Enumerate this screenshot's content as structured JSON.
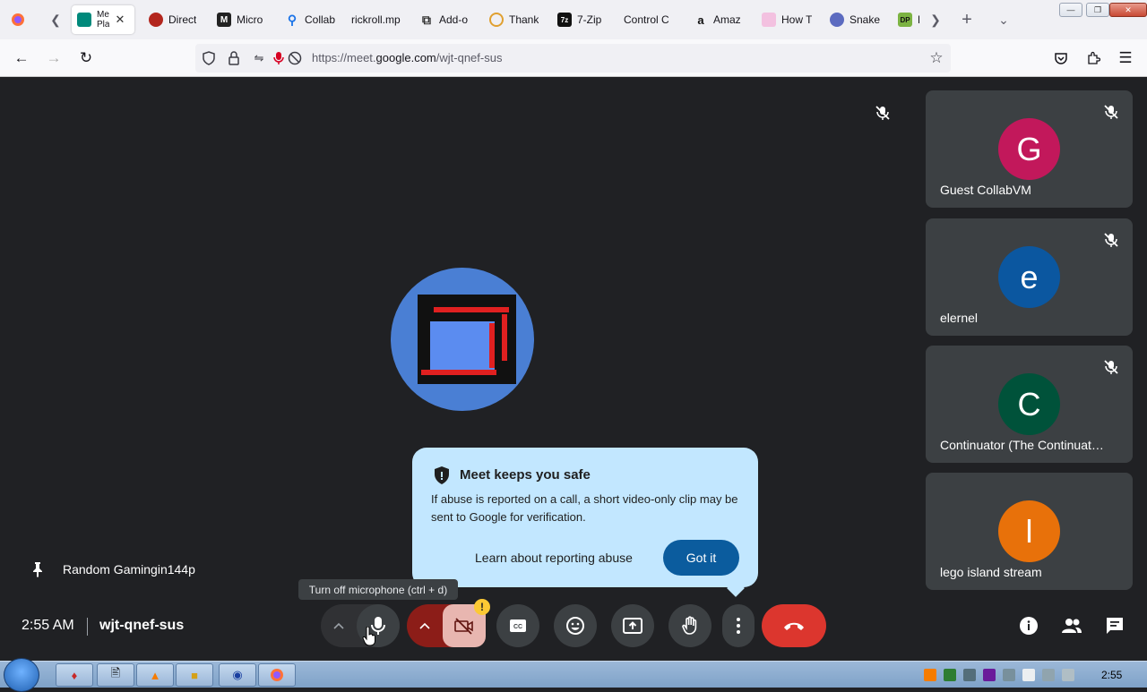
{
  "browser": {
    "tabs": [
      {
        "label": "Me",
        "sub": "Pla",
        "color": "#00897b",
        "letter": ""
      },
      {
        "label": "Direct",
        "color": "#b3261e",
        "letter": ""
      },
      {
        "label": "Micro",
        "color": "#222222",
        "letter": "M"
      },
      {
        "label": "Collab",
        "color": "#1a73e8",
        "letter": ""
      },
      {
        "label": "rickroll.mp",
        "color": "",
        "letter": ""
      },
      {
        "label": "Add-o",
        "color": "#555555",
        "letter": ""
      },
      {
        "label": "Thank",
        "color": "#e0a030",
        "letter": ""
      },
      {
        "label": "7-Zip",
        "color": "#111111",
        "letter": "7z"
      },
      {
        "label": "Control C",
        "color": "",
        "letter": ""
      },
      {
        "label": "Amaz",
        "color": "#222222",
        "letter": "a"
      },
      {
        "label": "How T",
        "color": "#e040a0",
        "letter": ""
      },
      {
        "label": "Snake",
        "color": "#5c6bc0",
        "letter": ""
      },
      {
        "label": "D",
        "color": "#7cb342",
        "letter": "DP"
      }
    ],
    "url_prefix": "https://meet.",
    "url_domain": "google.com",
    "url_path": "/wjt-qnef-sus"
  },
  "meet": {
    "participants": [
      {
        "initial": "G",
        "name": "Guest CollabVM",
        "color": "#c2185b"
      },
      {
        "initial": "e",
        "name": "elernel",
        "color": "#0b57a0"
      },
      {
        "initial": "C",
        "name": "Continuator (The Continuat…",
        "color": "#00523a"
      },
      {
        "initial": "l",
        "name": "lego island stream",
        "color": "#e8710a"
      }
    ],
    "pinned_name": "Random Gamingin144p",
    "popup": {
      "title": "Meet keeps you safe",
      "body": "If abuse is reported on a call, a short video-only clip may be sent to Google for verification.",
      "link": "Learn about reporting abuse",
      "button": "Got it"
    },
    "tooltip": "Turn off microphone (ctrl + d)",
    "time": "2:55 AM",
    "meeting_code": "wjt-qnef-sus",
    "warning_badge": "!"
  },
  "taskbar": {
    "time": "2:55"
  }
}
